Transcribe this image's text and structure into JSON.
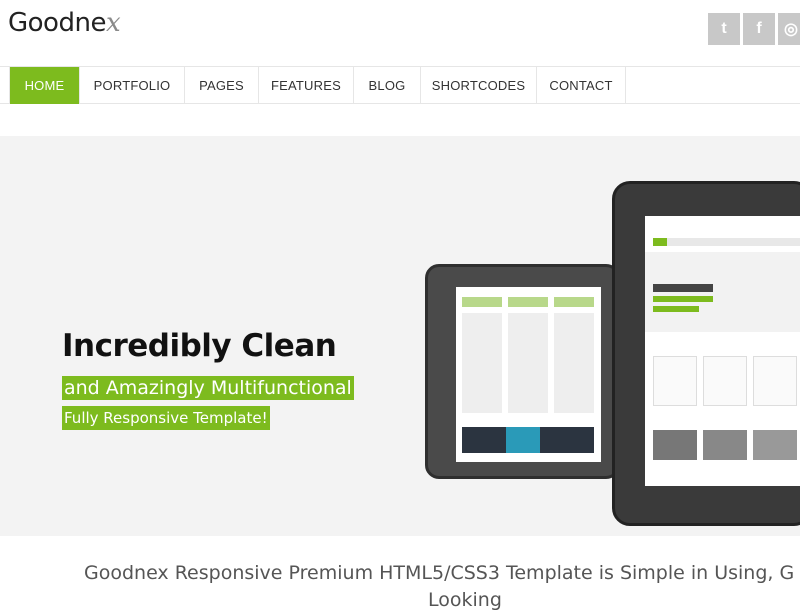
{
  "logo": {
    "main": "Goodne",
    "tail": "x"
  },
  "social": [
    {
      "icon": "twitter-icon",
      "glyph": "t"
    },
    {
      "icon": "facebook-icon",
      "glyph": "f"
    },
    {
      "icon": "dribbble-icon",
      "glyph": "◎"
    }
  ],
  "nav": [
    "HOME",
    "PORTFOLIO",
    "PAGES",
    "FEATURES",
    "BLOG",
    "SHORTCODES",
    "CONTACT"
  ],
  "hero": {
    "title": "Incredibly Clean",
    "subtitle": "and Amazingly Multifunctional",
    "tagline": "Fully Responsive Template!"
  },
  "intro": {
    "line1": "Goodnex Responsive Premium HTML5/CSS3 Template is Simple in Using, G",
    "line2": "Looking"
  },
  "colors": {
    "accent": "#7dbb1e",
    "social": "#c8c8c8"
  }
}
